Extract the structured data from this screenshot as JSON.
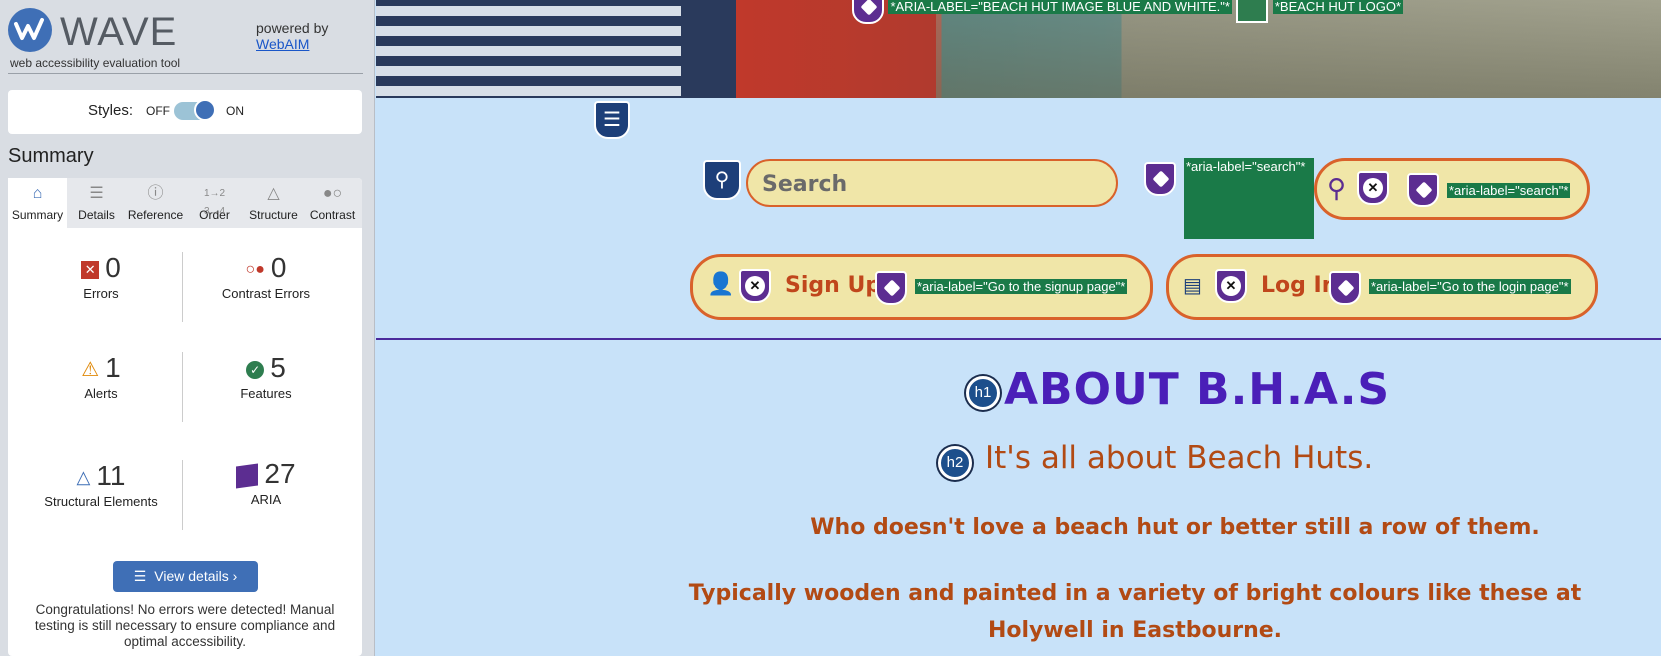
{
  "wave": {
    "name": "WAVE",
    "tagline": "web accessibility evaluation tool",
    "powered_by": "powered by",
    "webaim": "WebAIM"
  },
  "styles": {
    "label": "Styles:",
    "off": "OFF",
    "on": "ON"
  },
  "summary": {
    "title": "Summary",
    "tabs": [
      {
        "label": "Summary",
        "icon": "home-icon"
      },
      {
        "label": "Details",
        "icon": "list-icon"
      },
      {
        "label": "Reference",
        "icon": "info-icon"
      },
      {
        "label": "Order",
        "icon": "order-icon"
      },
      {
        "label": "Structure",
        "icon": "structure-icon"
      },
      {
        "label": "Contrast",
        "icon": "contrast-icon"
      }
    ],
    "stats": {
      "errors": {
        "value": "0",
        "label": "Errors"
      },
      "contrast_errors": {
        "value": "0",
        "label": "Contrast Errors"
      },
      "alerts": {
        "value": "1",
        "label": "Alerts"
      },
      "features": {
        "value": "5",
        "label": "Features"
      },
      "structural": {
        "value": "11",
        "label": "Structural Elements"
      },
      "aria": {
        "value": "27",
        "label": "ARIA"
      }
    },
    "view_details": "View details ›",
    "congrats": "Congratulations! No errors were detected! Manual testing is still necessary to ensure compliance and optimal accessibility."
  },
  "page": {
    "hero_tag1": "*ARIA-LABEL=\"BEACH HUT IMAGE BLUE AND WHITE.\"*",
    "hero_tag2": "*BEACH HUT LOGO*",
    "search_placeholder": "Search",
    "search_aria1": "*aria-label=\"search\"*",
    "search_aria2": "*aria-label=\"search\"*",
    "signup_label": "Sign Up",
    "signup_aria": "*aria-label=\"Go to the signup page\"*",
    "login_label": "Log In",
    "login_aria": "*aria-label=\"Go to the login page\"*",
    "h1": "ABOUT B.H.A.S",
    "h2": "It's all about Beach Huts.",
    "p1": "Who doesn't love a beach hut or better still a row of them.",
    "p2": "Typically wooden and painted in a variety of bright colours like these at Holywell in Eastbourne.",
    "h1_badge": "h1",
    "h2_badge": "h2"
  }
}
